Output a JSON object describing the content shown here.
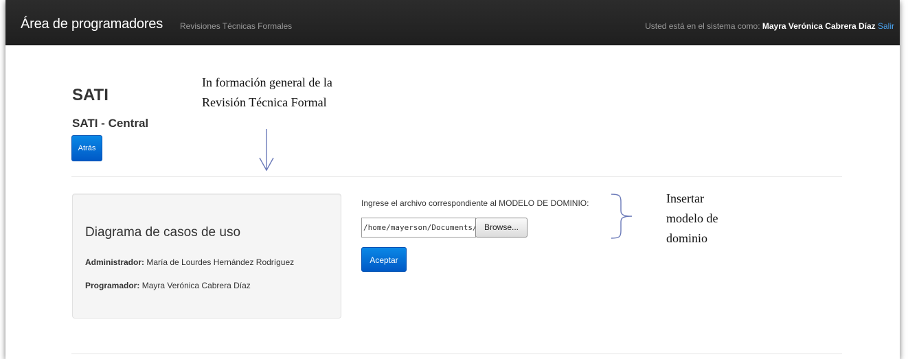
{
  "navbar": {
    "brand": "Área de programadores",
    "link": "Revisiones Técnicas Formales",
    "user_prefix": "Usted está en el sistema como:",
    "user_name": "Mayra Verónica Cabrera Díaz",
    "logout": "Salir"
  },
  "header": {
    "title": "SATI",
    "subtitle": "SATI - Central",
    "back_button": "Atrás"
  },
  "annotations": {
    "top_line1": "In formación general de la",
    "top_line2": "Revisión Técnica Formal",
    "right_line1": "Insertar",
    "right_line2": "modelo de",
    "right_line3": "dominio"
  },
  "info_panel": {
    "title": "Diagrama de casos de uso",
    "admin_label": "Administrador:",
    "admin_value": "María de Lourdes Hernández Rodríguez",
    "programmer_label": "Programador:",
    "programmer_value": "Mayra Verónica Cabrera Díaz"
  },
  "upload": {
    "label": "Ingrese el archivo correspondiente al MODELO DE DOMINIO:",
    "file_value": "/home/mayerson/Documents/",
    "browse_button": "Browse...",
    "submit_button": "Aceptar"
  },
  "colors": {
    "navbar_bg": "#222222",
    "primary": "#0074cc",
    "link_blue": "#4aa3f0",
    "annotation_line": "#6a79b8"
  },
  "icons": {
    "arrow": "down-arrow-icon",
    "brace": "right-brace-icon"
  }
}
